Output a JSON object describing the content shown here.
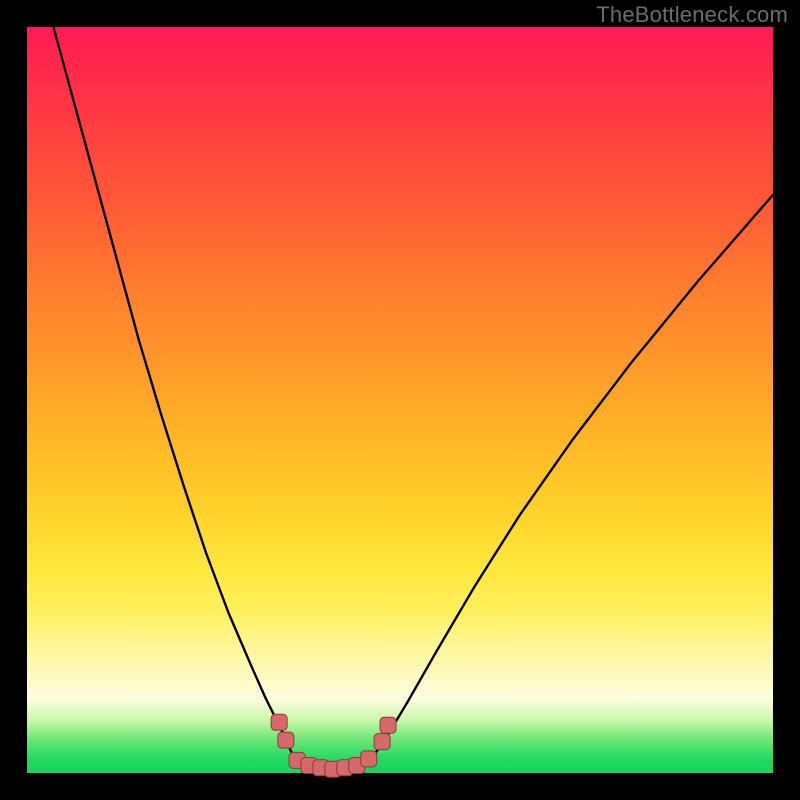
{
  "watermark": {
    "text": "TheBottleneck.com"
  },
  "colors": {
    "background": "#000000",
    "curve": "#000000",
    "marker_fill": "#d66a6a",
    "marker_stroke": "#8a3a3a",
    "gradient_top": "#ff1a55",
    "gradient_bottom": "#17d65d"
  },
  "chart_data": {
    "type": "line",
    "title": "",
    "xlabel": "",
    "ylabel": "",
    "xlim": [
      0,
      100
    ],
    "ylim": [
      0,
      100
    ],
    "grid": false,
    "legend": false,
    "note": "Axes have no visible tick labels; x/y are in percent of plot width/height. y=0 is top, y=100 is bottom (matching the rendered image).",
    "series": [
      {
        "name": "left-branch",
        "x": [
          3.0,
          6.0,
          9.0,
          12.0,
          15.0,
          18.0,
          21.0,
          24.0,
          27.0,
          30.0,
          32.0,
          34.0,
          35.2,
          36.0
        ],
        "y": [
          -2.0,
          9.0,
          20.0,
          31.0,
          42.0,
          52.0,
          61.5,
          70.5,
          78.5,
          85.5,
          90.0,
          94.0,
          96.7,
          98.3
        ]
      },
      {
        "name": "valley-floor",
        "x": [
          36.0,
          37.5,
          39.0,
          40.5,
          42.0,
          43.5,
          45.0,
          46.0
        ],
        "y": [
          98.3,
          99.0,
          99.3,
          99.5,
          99.5,
          99.3,
          99.0,
          98.3
        ]
      },
      {
        "name": "right-branch",
        "x": [
          46.0,
          48.0,
          51.0,
          55.0,
          60.0,
          66.0,
          73.0,
          81.0,
          90.0,
          100.0
        ],
        "y": [
          98.3,
          95.5,
          90.5,
          83.5,
          75.0,
          65.5,
          55.5,
          45.0,
          34.0,
          22.5
        ]
      }
    ],
    "markers": {
      "name": "highlight-points",
      "shape": "rounded-square",
      "points": [
        {
          "x": 33.8,
          "y": 93.2
        },
        {
          "x": 34.7,
          "y": 95.6
        },
        {
          "x": 36.2,
          "y": 98.3
        },
        {
          "x": 37.8,
          "y": 99.0
        },
        {
          "x": 39.4,
          "y": 99.3
        },
        {
          "x": 41.0,
          "y": 99.5
        },
        {
          "x": 42.6,
          "y": 99.3
        },
        {
          "x": 44.2,
          "y": 99.0
        },
        {
          "x": 45.8,
          "y": 98.1
        },
        {
          "x": 47.6,
          "y": 95.8
        },
        {
          "x": 48.4,
          "y": 93.6
        }
      ]
    }
  }
}
